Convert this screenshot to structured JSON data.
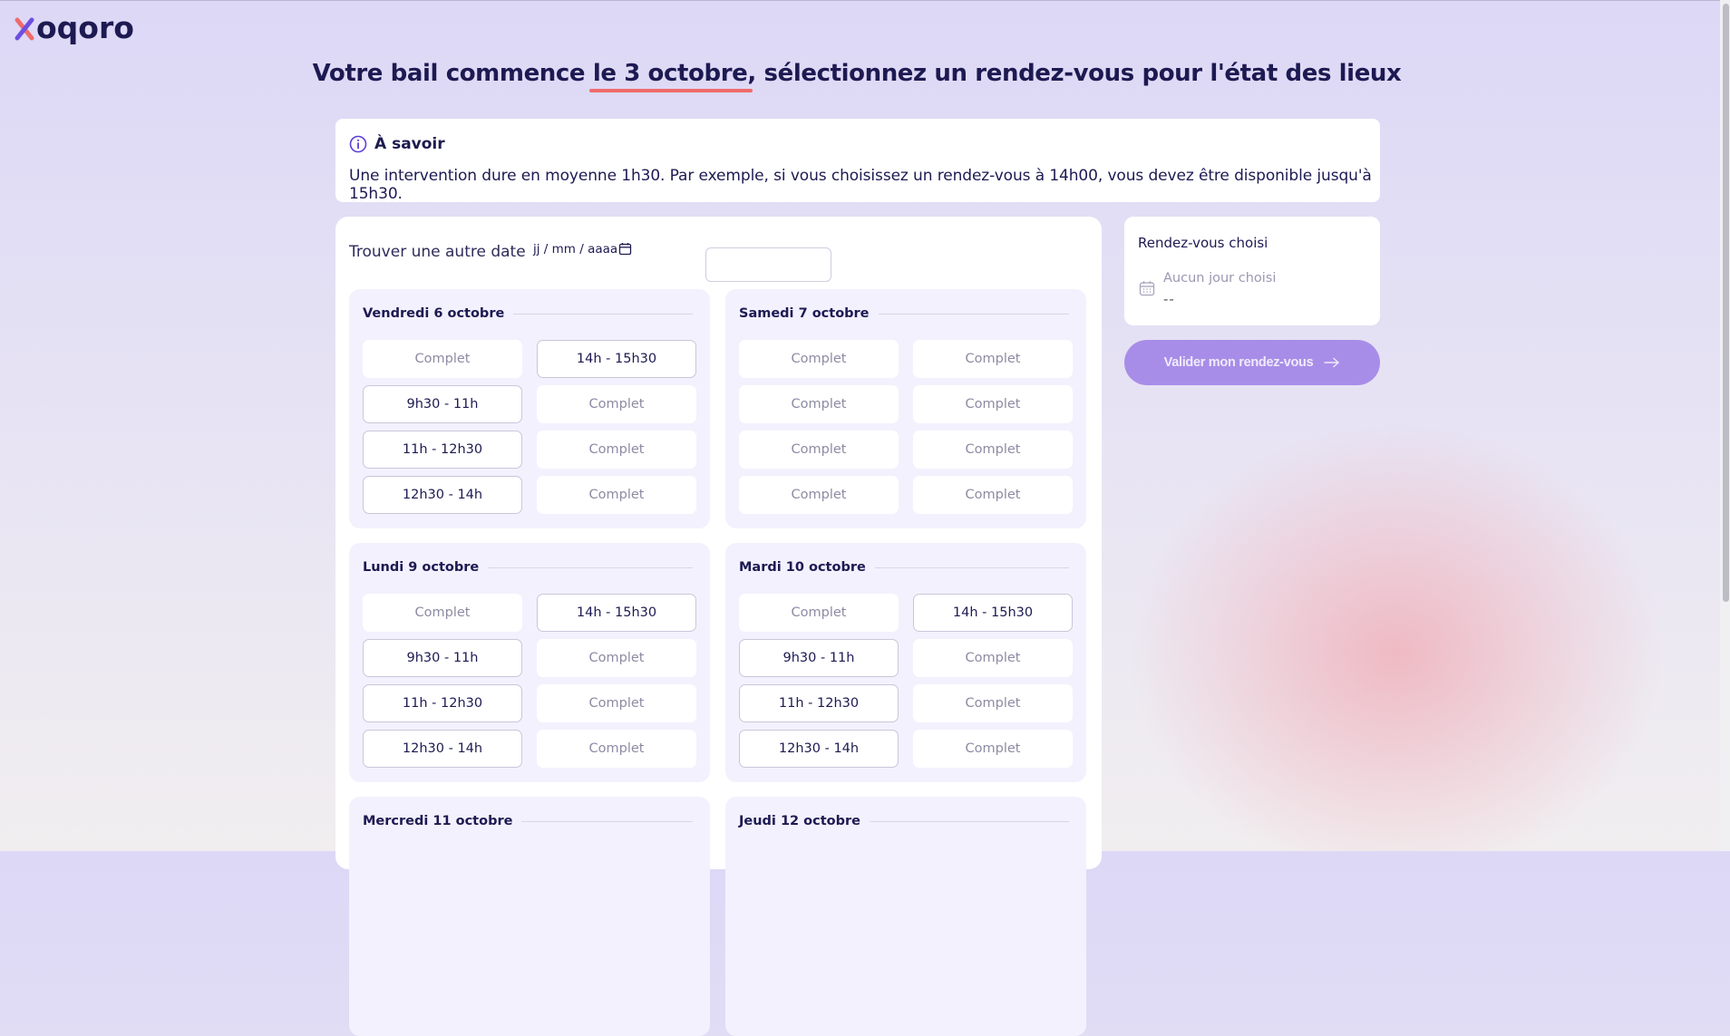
{
  "brand": {
    "name": "oqoro",
    "accent": "#ef6b6b",
    "primary": "#1d1a52"
  },
  "header": {
    "title_before": "Votre bail commence ",
    "title_highlight": "le 3 octobre",
    "title_after": ", sélectionnez un rendez-vous pour l'état des lieux"
  },
  "info": {
    "icon": "info-icon",
    "heading": "À savoir",
    "text": "Une intervention dure en moyenne 1h30. Par exemple, si vous choisissez un rendez-vous à 14h00, vous devez être disponible jusqu'à 15h30."
  },
  "date_search": {
    "label": "Trouver une autre date",
    "placeholder": "jj / mm / aaaa",
    "icon": "calendar-icon"
  },
  "days": [
    {
      "title": "Vendredi 6 octobre",
      "slots": [
        {
          "label": "Complet",
          "available": false
        },
        {
          "label": "14h - 15h30",
          "available": true
        },
        {
          "label": "9h30 - 11h",
          "available": true
        },
        {
          "label": "Complet",
          "available": false
        },
        {
          "label": "11h - 12h30",
          "available": true
        },
        {
          "label": "Complet",
          "available": false
        },
        {
          "label": "12h30 - 14h",
          "available": true
        },
        {
          "label": "Complet",
          "available": false
        }
      ]
    },
    {
      "title": "Samedi 7 octobre",
      "slots": [
        {
          "label": "Complet",
          "available": false
        },
        {
          "label": "Complet",
          "available": false
        },
        {
          "label": "Complet",
          "available": false
        },
        {
          "label": "Complet",
          "available": false
        },
        {
          "label": "Complet",
          "available": false
        },
        {
          "label": "Complet",
          "available": false
        },
        {
          "label": "Complet",
          "available": false
        },
        {
          "label": "Complet",
          "available": false
        }
      ]
    },
    {
      "title": "Lundi 9 octobre",
      "slots": [
        {
          "label": "Complet",
          "available": false
        },
        {
          "label": "14h - 15h30",
          "available": true
        },
        {
          "label": "9h30 - 11h",
          "available": true
        },
        {
          "label": "Complet",
          "available": false
        },
        {
          "label": "11h - 12h30",
          "available": true
        },
        {
          "label": "Complet",
          "available": false
        },
        {
          "label": "12h30 - 14h",
          "available": true
        },
        {
          "label": "Complet",
          "available": false
        }
      ]
    },
    {
      "title": "Mardi 10 octobre",
      "slots": [
        {
          "label": "Complet",
          "available": false
        },
        {
          "label": "14h - 15h30",
          "available": true
        },
        {
          "label": "9h30 - 11h",
          "available": true
        },
        {
          "label": "Complet",
          "available": false
        },
        {
          "label": "11h - 12h30",
          "available": true
        },
        {
          "label": "Complet",
          "available": false
        },
        {
          "label": "12h30 - 14h",
          "available": true
        },
        {
          "label": "Complet",
          "available": false
        }
      ]
    },
    {
      "title": "Mercredi 11 octobre",
      "slots": []
    },
    {
      "title": "Jeudi 12 octobre",
      "slots": []
    }
  ],
  "summary": {
    "title": "Rendez-vous choisi",
    "icon": "calendar-icon",
    "day": "Aucun jour choisi",
    "time": "--"
  },
  "validate": {
    "label": "Valider mon rendez-vous",
    "icon": "arrow-right-icon"
  }
}
